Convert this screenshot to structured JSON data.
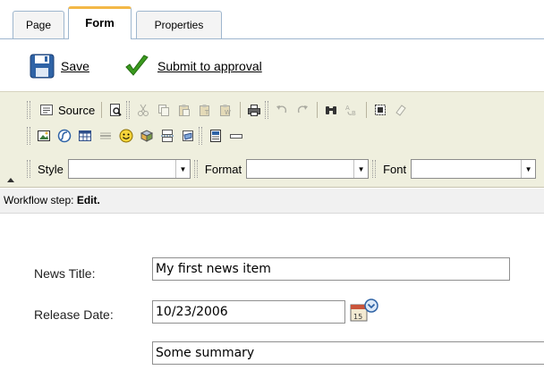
{
  "tabs": [
    {
      "label": "Page",
      "active": false
    },
    {
      "label": "Form",
      "active": true
    },
    {
      "label": "Properties",
      "active": false
    }
  ],
  "actions": {
    "save_label": "Save",
    "submit_label": "Submit to approval"
  },
  "toolbar": {
    "source_label": "Source",
    "style_label": "Style",
    "style_value": "",
    "format_label": "Format",
    "format_value": "",
    "font_label": "Font",
    "font_value": ""
  },
  "workflow": {
    "prefix": "Workflow step: ",
    "step": "Edit."
  },
  "form": {
    "news_title_label": "News Title:",
    "news_title_value": "My first news item",
    "release_date_label": "Release Date:",
    "release_date_value": "10/23/2006",
    "summary_value": "Some summary"
  },
  "colors": {
    "toolbar_bg": "#efefde",
    "active_tab_accent": "#f3b847",
    "tab_border": "#9eb6ce",
    "approve_check": "#3a9a1e",
    "save_disk": "#2f63a6"
  }
}
